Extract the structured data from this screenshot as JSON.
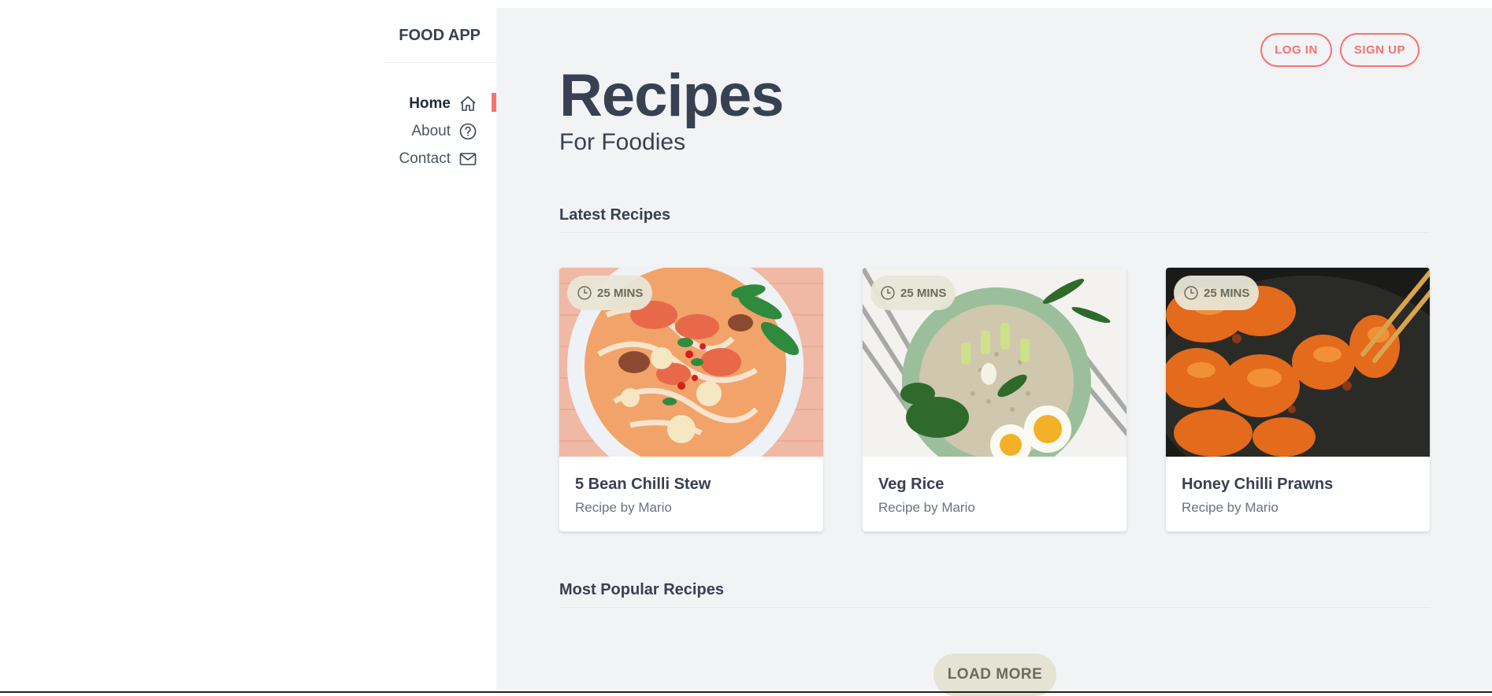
{
  "app": {
    "brand": "FOOD APP"
  },
  "nav": {
    "items": [
      {
        "label": "Home",
        "icon": "home-icon",
        "active": true
      },
      {
        "label": "About",
        "icon": "question-circle-icon",
        "active": false
      },
      {
        "label": "Contact",
        "icon": "envelope-icon",
        "active": false
      }
    ]
  },
  "auth": {
    "login_label": "LOG IN",
    "signup_label": "SIGN UP"
  },
  "hero": {
    "title": "Recipes",
    "subtitle": "For Foodies"
  },
  "latest": {
    "heading": "Latest Recipes",
    "cards": [
      {
        "time": "25 MINS",
        "title": "5 Bean Chilli Stew",
        "author": "Recipe by Mario",
        "image": "noodle-soup-bowl"
      },
      {
        "time": "25 MINS",
        "title": "Veg Rice",
        "author": "Recipe by Mario",
        "image": "veg-rice-bowl"
      },
      {
        "time": "25 MINS",
        "title": "Honey Chilli Prawns",
        "author": "Recipe by Mario",
        "image": "glazed-prawns"
      }
    ]
  },
  "popular": {
    "heading": "Most Popular Recipes"
  },
  "load_more_label": "LOAD MORE",
  "colors": {
    "accent": "#f87171",
    "main_bg": "#f2f3f5",
    "text": "#374151",
    "badge_bg": "#e8e6d6"
  }
}
